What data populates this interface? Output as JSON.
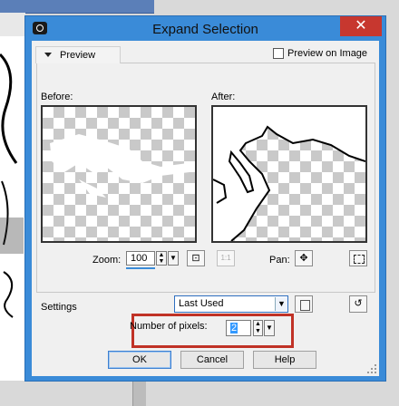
{
  "dialog": {
    "title": "Expand Selection",
    "close_glyph": "✕"
  },
  "preview": {
    "tab_label": "Preview",
    "preview_on_image_label": "Preview on Image",
    "preview_on_image_checked": false,
    "before_label": "Before:",
    "after_label": "After:"
  },
  "zoom": {
    "label": "Zoom:",
    "value": "100"
  },
  "pan": {
    "label": "Pan:"
  },
  "settings": {
    "label": "Settings",
    "selected": "Last Used"
  },
  "pixels": {
    "label": "Number of pixels:",
    "value": "2"
  },
  "buttons": {
    "ok": "OK",
    "cancel": "Cancel",
    "help": "Help"
  },
  "colors": {
    "title_bar": "#3a8bd8",
    "close_button": "#c7372f",
    "highlight": "#c03226"
  }
}
